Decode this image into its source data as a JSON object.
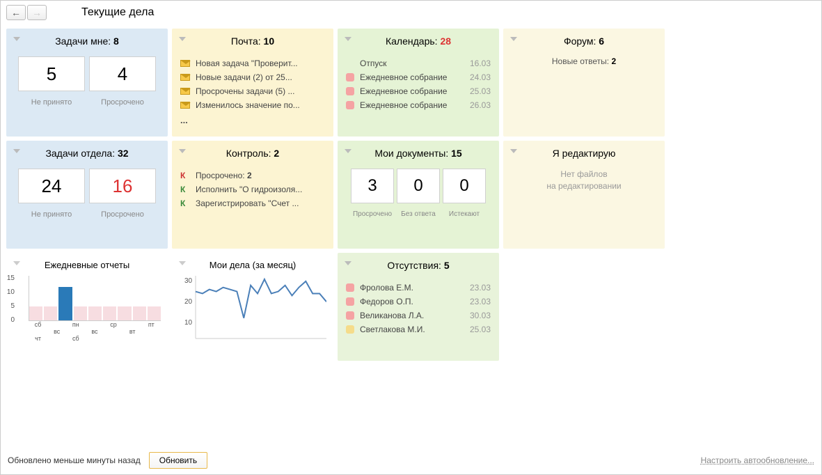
{
  "pageTitle": "Текущие дела",
  "tasksMine": {
    "title": "Задачи мне:",
    "count": "8",
    "box1": "5",
    "box2": "4",
    "label1": "Не принято",
    "label2": "Просрочено"
  },
  "mail": {
    "title": "Почта:",
    "count": "10",
    "items": [
      {
        "text": "Новая задача \"Проверит..."
      },
      {
        "text": "Новые задачи (2) от 25..."
      },
      {
        "text": "Просрочены задачи (5) ..."
      },
      {
        "text": "Изменилось значение по..."
      }
    ],
    "more": "..."
  },
  "calendar": {
    "title": "Календарь:",
    "count": "28",
    "items": [
      {
        "text": "Отпуск",
        "date": "16.03",
        "marker": ""
      },
      {
        "text": "Ежедневное собрание",
        "date": "24.03",
        "marker": "pink"
      },
      {
        "text": "Ежедневное собрание",
        "date": "25.03",
        "marker": "pink"
      },
      {
        "text": "Ежедневное собрание",
        "date": "26.03",
        "marker": "pink"
      }
    ]
  },
  "forum": {
    "title": "Форум:",
    "count": "6",
    "line1": "Новые ответы:",
    "line1count": "2"
  },
  "tasksDept": {
    "title": "Задачи отдела:",
    "count": "32",
    "box1": "24",
    "box2": "16",
    "label1": "Не принято",
    "label2": "Просрочено"
  },
  "control": {
    "title": "Контроль:",
    "count": "2",
    "items": [
      {
        "k": "red",
        "text": "Просрочено: ",
        "bold": "2"
      },
      {
        "k": "green",
        "text": "Исполнить \"О гидроизоля..."
      },
      {
        "k": "green",
        "text": "Зарегистрировать \"Счет ..."
      }
    ]
  },
  "mydocs": {
    "title": "Мои документы:",
    "count": "15",
    "box1": "3",
    "box2": "0",
    "box3": "0",
    "label1": "Просрочено",
    "label2": "Без ответа",
    "label3": "Истекают"
  },
  "editing": {
    "title": "Я редактирую",
    "text1": "Нет файлов",
    "text2": "на редактировании"
  },
  "absences": {
    "title": "Отсутствия:",
    "count": "5",
    "items": [
      {
        "marker": "pink",
        "text": "Фролова Е.М.",
        "date": "23.03"
      },
      {
        "marker": "pink",
        "text": "Федоров О.П.",
        "date": "23.03"
      },
      {
        "marker": "pink",
        "text": "Великанова Л.А.",
        "date": "30.03"
      },
      {
        "marker": "yellow",
        "text": "Светлакова М.И.",
        "date": "25.03"
      }
    ]
  },
  "dailyReports": {
    "title": "Ежедневные отчеты"
  },
  "myDeals": {
    "title": "Мои дела (за месяц)"
  },
  "bottom": {
    "updated": "Обновлено меньше минуты назад",
    "refresh": "Обновить",
    "settings": "Настроить автообновление..."
  },
  "chart_data": [
    {
      "type": "bar",
      "title": "Ежедневные отчеты",
      "categories": [
        "сб",
        "вс",
        "пн",
        "вт",
        "ср",
        "чт",
        "пт",
        "сб",
        "вс"
      ],
      "values": [
        5,
        5,
        12,
        5,
        5,
        5,
        5,
        5,
        5
      ],
      "ylim": [
        0,
        15
      ],
      "active_index": 2,
      "ylabel": "",
      "xlabel": ""
    },
    {
      "type": "line",
      "title": "Мои дела (за месяц)",
      "x": [
        1,
        2,
        3,
        4,
        5,
        6,
        7,
        8,
        9,
        10,
        11,
        12,
        13,
        14,
        15,
        16,
        17,
        18,
        19,
        20
      ],
      "values": [
        23,
        22,
        24,
        23,
        25,
        24,
        23,
        10,
        26,
        22,
        29,
        22,
        23,
        26,
        21,
        25,
        28,
        22,
        22,
        18
      ],
      "ylim": [
        0,
        30
      ],
      "ylabel": "",
      "xlabel": ""
    }
  ]
}
